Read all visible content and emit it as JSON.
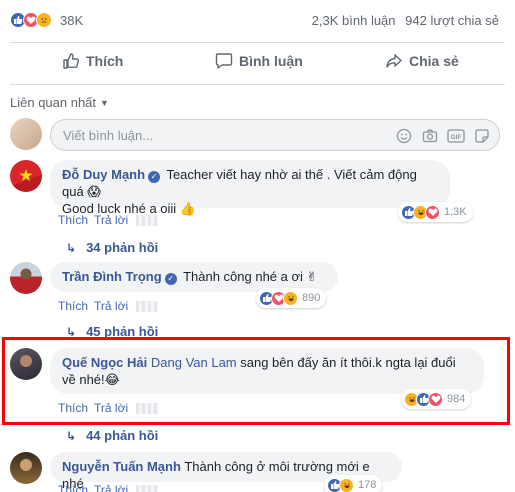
{
  "summary": {
    "reaction_count": "38K",
    "comments": "2,3K bình luận",
    "shares": "942 lượt chia sẻ"
  },
  "actions": {
    "like": "Thích",
    "comment": "Bình luận",
    "share": "Chia sẻ"
  },
  "sort": {
    "label": "Liên quan nhất"
  },
  "composer": {
    "placeholder": "Viết bình luận..."
  },
  "comments": [
    {
      "author": "Đỗ Duy Mạnh",
      "text_line1": "Teacher viết hay nhờ ai thế . Viết cảm động quá 😱",
      "text_line2": "Good luck nhé a oiii 👍",
      "like": "Thích",
      "reply": "Trả lời",
      "reaction_count": "1,3K",
      "replies": "34 phản hồi"
    },
    {
      "author": "Trần Đình Trọng",
      "text_line1": "Thành công nhé a ơi ✌",
      "like": "Thích",
      "reply": "Trả lời",
      "reaction_count": "890",
      "replies": "45 phản hồi"
    },
    {
      "author": "Quế Ngọc Hải",
      "mention": "Dang Van Lam",
      "text_line1": " sang bên đấy ăn ít thôi.k ngta lại đuổi",
      "text_line2": "về nhé!😂",
      "like": "Thích",
      "reply": "Trả lời",
      "reaction_count": "984",
      "replies": "44 phản hồi"
    },
    {
      "author": "Nguyễn Tuấn Mạnh",
      "text_line1": "Thành công ở môi trường mới e nhé",
      "like": "Thích",
      "reply": "Trả lời",
      "reaction_count": "178"
    }
  ],
  "colors": {
    "link_blue": "#385898",
    "like_blue": "#4267b2",
    "love_red": "#f25268",
    "haha_yellow": "#f7b125",
    "highlight_red": "#ff0000"
  }
}
